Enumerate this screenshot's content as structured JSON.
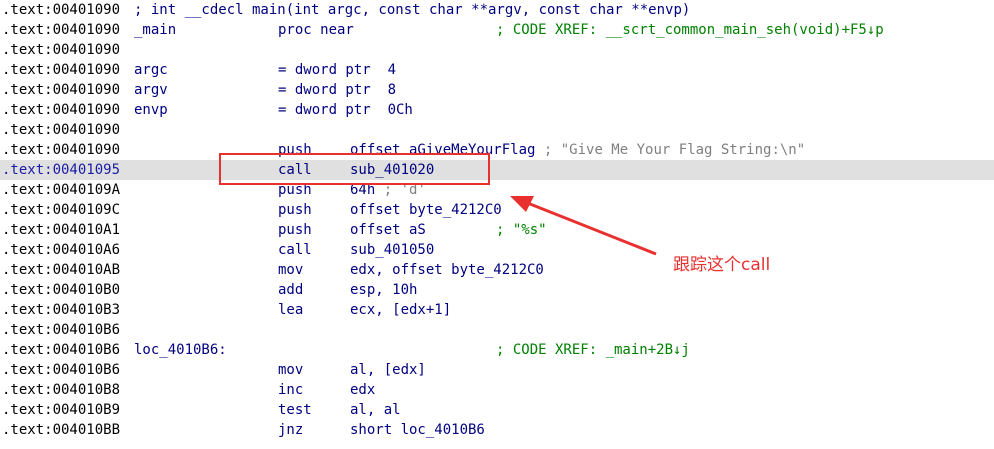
{
  "lines": [
    {
      "addr": ".text:00401090",
      "proto": "; int __cdecl main(int argc, const char **argv, const char **envp)"
    },
    {
      "addr": ".text:00401090",
      "label": "_main",
      "mnemonic": "proc near",
      "comment": "; CODE XREF: __scrt_common_main_seh(void)+F5↓p"
    },
    {
      "addr": ".text:00401090"
    },
    {
      "addr": ".text:00401090",
      "label": "argc",
      "mnemonic": "= dword ptr  4"
    },
    {
      "addr": ".text:00401090",
      "label": "argv",
      "mnemonic": "= dword ptr  8"
    },
    {
      "addr": ".text:00401090",
      "label": "envp",
      "mnemonic": "= dword ptr  0Ch"
    },
    {
      "addr": ".text:00401090"
    },
    {
      "addr": ".text:00401090",
      "mnemonic": "push",
      "operand": "offset aGiveMeYourFlag",
      "inline_comment": " ; \"Give Me Your Flag String:\\n\""
    },
    {
      "addr": ".text:00401095",
      "mnemonic": "call",
      "operand": "sub_401020",
      "highlighted": true
    },
    {
      "addr": ".text:0040109A",
      "mnemonic": "push",
      "operand": "64h",
      "inline_comment": " ; 'd'"
    },
    {
      "addr": ".text:0040109C",
      "mnemonic": "push",
      "operand": "offset byte_4212C0"
    },
    {
      "addr": ".text:004010A1",
      "mnemonic": "push",
      "operand": "offset aS",
      "comment": "; \"%s\""
    },
    {
      "addr": ".text:004010A6",
      "mnemonic": "call",
      "operand": "sub_401050"
    },
    {
      "addr": ".text:004010AB",
      "mnemonic": "mov",
      "operand": "edx, offset byte_4212C0"
    },
    {
      "addr": ".text:004010B0",
      "mnemonic": "add",
      "operand": "esp, 10h"
    },
    {
      "addr": ".text:004010B3",
      "mnemonic": "lea",
      "operand": "ecx, [edx+1]"
    },
    {
      "addr": ".text:004010B6"
    },
    {
      "addr": ".text:004010B6",
      "label": "loc_4010B6:",
      "comment": "; CODE XREF: _main+2B↓j"
    },
    {
      "addr": ".text:004010B6",
      "mnemonic": "mov",
      "operand": "al, [edx]"
    },
    {
      "addr": ".text:004010B8",
      "mnemonic": "inc",
      "operand": "edx"
    },
    {
      "addr": ".text:004010B9",
      "mnemonic": "test",
      "operand": "al, al"
    },
    {
      "addr": ".text:004010BB",
      "mnemonic": "jnz",
      "operand": "short loc_4010B6"
    }
  ],
  "annotation": {
    "text": "跟踪这个call",
    "color": "#e8312f"
  },
  "colors": {
    "code": "#000080",
    "comment": "#008000",
    "string_comment": "#808080",
    "highlight_bg": "#e0e0e0",
    "highlight_addr": "#1a1aa6"
  }
}
